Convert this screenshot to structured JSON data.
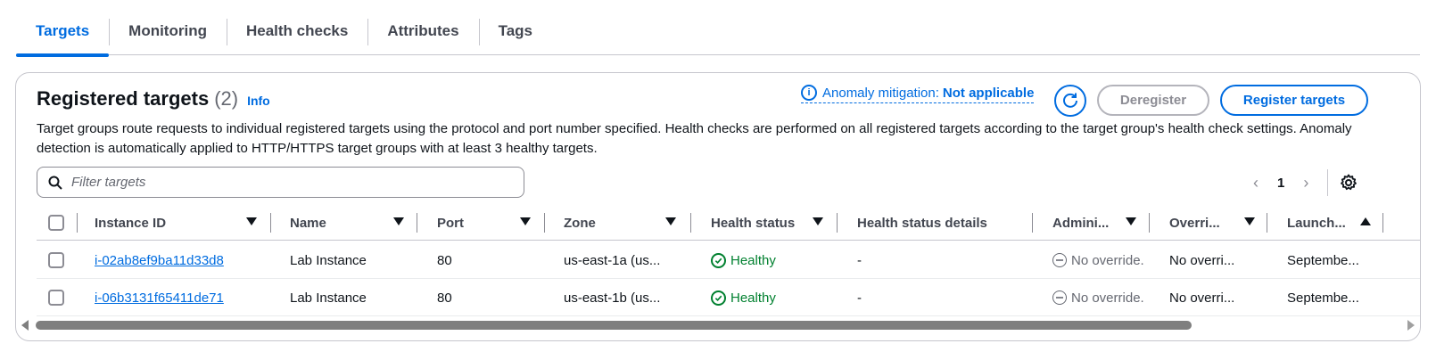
{
  "tabs": [
    {
      "label": "Targets",
      "active": true
    },
    {
      "label": "Monitoring",
      "active": false
    },
    {
      "label": "Health checks",
      "active": false
    },
    {
      "label": "Attributes",
      "active": false
    },
    {
      "label": "Tags",
      "active": false
    }
  ],
  "section": {
    "title": "Registered targets",
    "count": "(2)",
    "info": "Info",
    "description": "Target groups route requests to individual registered targets using the protocol and port number specified. Health checks are performed on all registered targets according to the target group's health check settings. Anomaly detection is automatically applied to HTTP/HTTPS target groups with at least 3 healthy targets.",
    "anomaly_label": "Anomaly mitigation:",
    "anomaly_value": "Not applicable",
    "deregister": "Deregister",
    "register": "Register targets"
  },
  "search": {
    "placeholder": "Filter targets"
  },
  "pagination": {
    "current_page": "1"
  },
  "table": {
    "columns": [
      {
        "label": "Instance ID"
      },
      {
        "label": "Name"
      },
      {
        "label": "Port"
      },
      {
        "label": "Zone"
      },
      {
        "label": "Health status"
      },
      {
        "label": "Health status details"
      },
      {
        "label": "Admini..."
      },
      {
        "label": "Overri..."
      },
      {
        "label": "Launch..."
      }
    ],
    "rows": [
      {
        "instance_id": "i-02ab8ef9ba11d33d8",
        "name": "Lab Instance",
        "port": "80",
        "zone": "us-east-1a (us...",
        "health": "Healthy",
        "details": "-",
        "admin": "No override.",
        "override": "No overri...",
        "launch": "Septembe..."
      },
      {
        "instance_id": "i-06b3131f65411de71",
        "name": "Lab Instance",
        "port": "80",
        "zone": "us-east-1b (us...",
        "health": "Healthy",
        "details": "-",
        "admin": "No override.",
        "override": "No overri...",
        "launch": "Septembe..."
      }
    ]
  },
  "colors": {
    "accent": "#006ce0",
    "success": "#00802f",
    "muted": "#656871"
  }
}
